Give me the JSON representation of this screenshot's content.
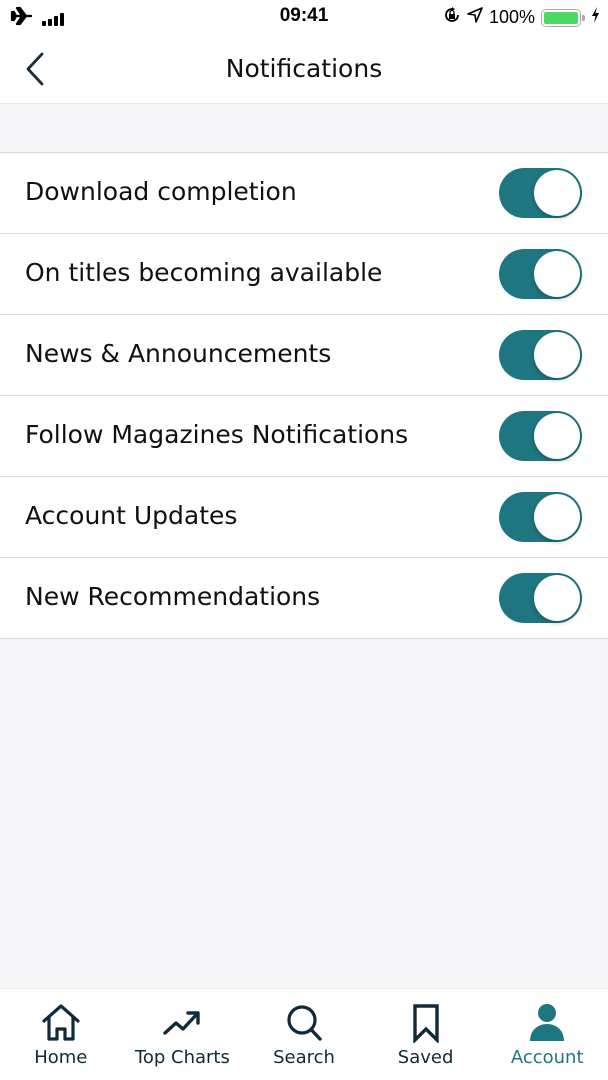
{
  "status_bar": {
    "time": "09:41",
    "battery_percent": "100%",
    "icons": [
      "airplane-icon",
      "signal-icon",
      "orientation-lock-icon",
      "location-icon",
      "battery-icon",
      "charging-icon"
    ]
  },
  "header": {
    "title": "Notifications",
    "back_icon": "chevron-left-icon"
  },
  "colors": {
    "accent": "#1e7680",
    "tab_inactive": "#102a3a",
    "battery": "#4cd964"
  },
  "settings": [
    {
      "label": "Download completion",
      "enabled": true
    },
    {
      "label": "On titles becoming available",
      "enabled": true
    },
    {
      "label": "News & Announcements",
      "enabled": true
    },
    {
      "label": "Follow Magazines Notifications",
      "enabled": true
    },
    {
      "label": "Account Updates",
      "enabled": true
    },
    {
      "label": "New Recommendations",
      "enabled": true
    }
  ],
  "tabs": [
    {
      "label": "Home",
      "icon": "home-icon",
      "active": false
    },
    {
      "label": "Top Charts",
      "icon": "trending-up-icon",
      "active": false
    },
    {
      "label": "Search",
      "icon": "search-icon",
      "active": false
    },
    {
      "label": "Saved",
      "icon": "bookmark-icon",
      "active": false
    },
    {
      "label": "Account",
      "icon": "person-icon",
      "active": true
    }
  ]
}
